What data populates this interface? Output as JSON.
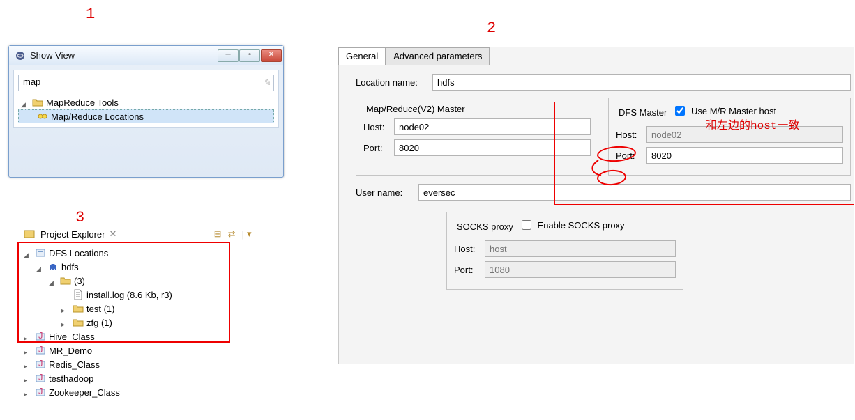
{
  "callouts": {
    "one": "1",
    "two": "2",
    "three": "3"
  },
  "show_view": {
    "title": "Show View",
    "filter_value": "map",
    "tree": {
      "category": "MapReduce Tools",
      "item": "Map/Reduce Locations"
    }
  },
  "explorer": {
    "title": "Project Explorer",
    "tree": {
      "root": "DFS Locations",
      "hdfs": "hdfs",
      "folder3": "(3)",
      "install_log": "install.log (8.6 Kb, r3)",
      "test": "test (1)",
      "zfg": "zfg (1)",
      "projects": [
        "Hive_Class",
        "MR_Demo",
        "Redis_Class",
        "testhadoop",
        "Zookeeper_Class"
      ]
    }
  },
  "config": {
    "tabs": {
      "general": "General",
      "advanced": "Advanced parameters"
    },
    "location_name_label": "Location name:",
    "location_name": "hdfs",
    "mr_master": {
      "legend": "Map/Reduce(V2) Master",
      "host_label": "Host:",
      "host": "node02",
      "port_label": "Port:",
      "port": "8020"
    },
    "dfs_master": {
      "legend": "DFS Master",
      "use_mr_label": "Use M/R Master host",
      "host_label": "Host:",
      "host": "node02",
      "port_label": "Port:",
      "port": "8020"
    },
    "user_name_label": "User name:",
    "user_name": "eversec",
    "socks": {
      "legend": "SOCKS proxy",
      "enable_label": "Enable SOCKS proxy",
      "host_label": "Host:",
      "host_placeholder": "host",
      "port_label": "Port:",
      "port_placeholder": "1080"
    },
    "annotation": "和左边的host一致"
  }
}
